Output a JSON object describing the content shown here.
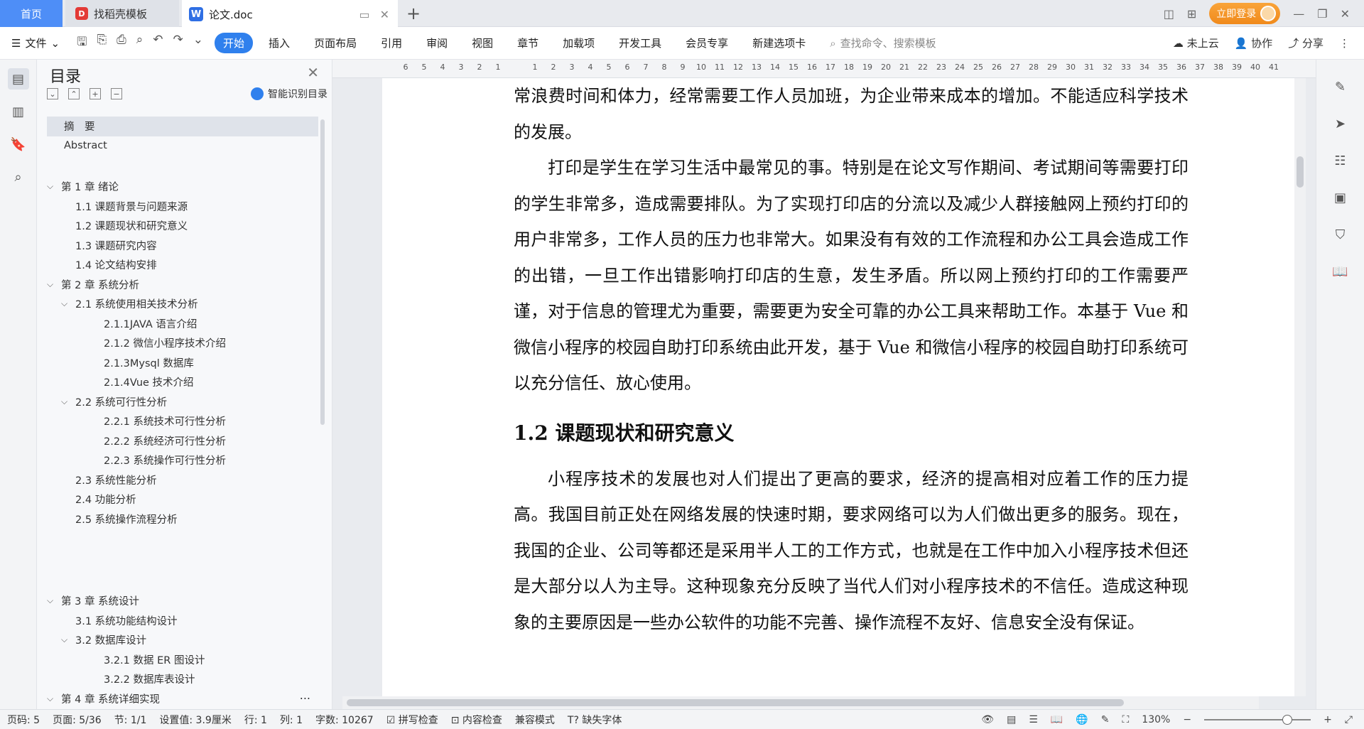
{
  "tabs": {
    "home": "首页",
    "template": "找稻壳模板",
    "doc": "论文.doc"
  },
  "title_right": {
    "login": "立即登录"
  },
  "menu": {
    "file": "文件",
    "items": [
      "开始",
      "插入",
      "页面布局",
      "引用",
      "审阅",
      "视图",
      "章节",
      "加载项",
      "开发工具",
      "会员专享",
      "新建选项卡"
    ],
    "search_placeholder": "查找命令、搜索模板",
    "cloud": "未上云",
    "collab": "协作",
    "share": "分享"
  },
  "toc": {
    "title": "目录",
    "smart": "智能识别目录",
    "items": [
      {
        "label": "摘　要"
      },
      {
        "label": "Abstract"
      },
      {
        "label": "第 1 章  绪论"
      },
      {
        "label": "1.1 课题背景与问题来源"
      },
      {
        "label": "1.2 课题现状和研究意义"
      },
      {
        "label": "1.3 课题研究内容"
      },
      {
        "label": "1.4 论文结构安排"
      },
      {
        "label": "第 2 章  系统分析"
      },
      {
        "label": "2.1 系统使用相关技术分析"
      },
      {
        "label": "2.1.1JAVA 语言介绍"
      },
      {
        "label": "2.1.2 微信小程序技术介绍"
      },
      {
        "label": "2.1.3Mysql 数据库"
      },
      {
        "label": "2.1.4Vue 技术介绍"
      },
      {
        "label": "2.2 系统可行性分析"
      },
      {
        "label": "2.2.1 系统技术可行性分析"
      },
      {
        "label": "2.2.2 系统经济可行性分析"
      },
      {
        "label": "2.2.3 系统操作可行性分析"
      },
      {
        "label": "2.3 系统性能分析"
      },
      {
        "label": "2.4 功能分析"
      },
      {
        "label": "2.5 系统操作流程分析"
      },
      {
        "label": "第 3 章  系统设计"
      },
      {
        "label": "3.1 系统功能结构设计"
      },
      {
        "label": "3.2 数据库设计"
      },
      {
        "label": "3.2.1 数据 ER 图设计"
      },
      {
        "label": "3.2.2 数据库表设计"
      },
      {
        "label": "第 4 章  系统详细实现"
      }
    ],
    "more": "..."
  },
  "ruler": [
    "6",
    "5",
    "4",
    "3",
    "2",
    "1",
    "",
    "1",
    "2",
    "3",
    "4",
    "5",
    "6",
    "7",
    "8",
    "9",
    "10",
    "11",
    "12",
    "13",
    "14",
    "15",
    "16",
    "17",
    "18",
    "19",
    "20",
    "21",
    "22",
    "23",
    "24",
    "25",
    "26",
    "27",
    "28",
    "29",
    "30",
    "31",
    "32",
    "33",
    "34",
    "35",
    "36",
    "37",
    "38",
    "39",
    "40",
    "41"
  ],
  "document": {
    "p1": "常浪费时间和体力，经常需要工作人员加班，为企业带来成本的增加。不能适应科学技术的发展。",
    "p2": "打印是学生在学习生活中最常见的事。特别是在论文写作期间、考试期间等需要打印的学生非常多，造成需要排队。为了实现打印店的分流以及减少人群接触网上预约打印的用户非常多，工作人员的压力也非常大。如果没有有效的工作流程和办公工具会造成工作的出错，一旦工作出错影响打印店的生意，发生矛盾。所以网上预约打印的工作需要严谨，对于信息的管理尤为重要，需要更为安全可靠的办公工具来帮助工作。本基于 Vue 和微信小程序的校园自助打印系统由此开发，基于 Vue 和微信小程序的校园自助打印系统可以充分信任、放心使用。",
    "h2": "1.2 课题现状和研究意义",
    "p3": "小程序技术的发展也对人们提出了更高的要求，经济的提高相对应着工作的压力提高。我国目前正处在网络发展的快速时期，要求网络可以为人们做出更多的服务。现在，我国的企业、公司等都还是采用半人工的工作方式，也就是在工作中加入小程序技术但还是大部分以人为主导。这种现象充分反映了当代人们对小程序技术的不信任。造成这种现象的主要原因是一些办公软件的功能不完善、操作流程不友好、信息安全没有保证。"
  },
  "status": {
    "page_code": "页码: 5",
    "page": "页面: 5/36",
    "section": "节: 1/1",
    "setting": "设置值: 3.9厘米",
    "row": "行: 1",
    "col": "列: 1",
    "words": "字数: 10267",
    "spell": "拼写检查",
    "content_check": "内容检查",
    "compat": "兼容模式",
    "missing_font": "缺失字体",
    "zoom": "130%"
  }
}
